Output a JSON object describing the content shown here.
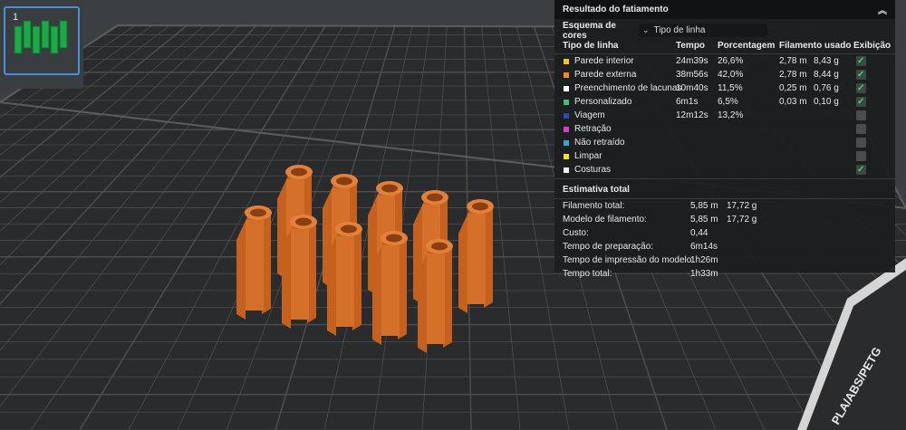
{
  "plate": {
    "index": "1",
    "label_text": "PLA/ABS/PETG"
  },
  "panel": {
    "title": "Resultado do fatiamento",
    "color_scheme_label": "Esquema de cores",
    "color_scheme_value": "Tipo de linha",
    "headers": {
      "type": "Tipo de linha",
      "time": "Tempo",
      "percent": "Porcentagem",
      "filament": "Filamento usado",
      "display": "Exibição"
    },
    "rows": [
      {
        "name": "Parede interior",
        "color": "#f5c518",
        "time": "24m39s",
        "percent": "26,6%",
        "meters": "2,78 m",
        "grams": "8,43 g",
        "shown": true
      },
      {
        "name": "Parede externa",
        "color": "#f08a2c",
        "time": "38m56s",
        "percent": "42,0%",
        "meters": "2,78 m",
        "grams": "8,44 g",
        "shown": true
      },
      {
        "name": "Preenchimento de lacunas",
        "color": "#ffffff",
        "time": "10m40s",
        "percent": "11,5%",
        "meters": "0,25 m",
        "grams": "0,76 g",
        "shown": true
      },
      {
        "name": "Personalizado",
        "color": "#3fbf7f",
        "time": "6m1s",
        "percent": "6,5%",
        "meters": "0,03 m",
        "grams": "0,10 g",
        "shown": true
      },
      {
        "name": "Viagem",
        "color": "#3446a8",
        "time": "12m12s",
        "percent": "13,2%",
        "meters": "",
        "grams": "",
        "shown": false
      },
      {
        "name": "Retração",
        "color": "#d43fc4",
        "time": "",
        "percent": "",
        "meters": "",
        "grams": "",
        "shown": false
      },
      {
        "name": "Não retraído",
        "color": "#38a8c8",
        "time": "",
        "percent": "",
        "meters": "",
        "grams": "",
        "shown": false
      },
      {
        "name": "Limpar",
        "color": "#f2e51a",
        "time": "",
        "percent": "",
        "meters": "",
        "grams": "",
        "shown": false
      },
      {
        "name": "Costuras",
        "color": "#f0f0f0",
        "time": "",
        "percent": "",
        "meters": "",
        "grams": "",
        "shown": true
      }
    ],
    "total_title": "Estimativa total",
    "totals": [
      {
        "label": "Filamento total:",
        "v1": "5,85 m",
        "v2": "17,72 g"
      },
      {
        "label": "Modelo de filamento:",
        "v1": "5,85 m",
        "v2": "17,72 g"
      },
      {
        "label": "Custo:",
        "v1": "0,44",
        "v2": ""
      },
      {
        "label": "Tempo de preparação:",
        "v1": "6m14s",
        "v2": ""
      },
      {
        "label": "Tempo de impressão do modelo:",
        "v1": "1h26m",
        "v2": ""
      },
      {
        "label": "Tempo total:",
        "v1": "1h33m",
        "v2": ""
      }
    ]
  }
}
